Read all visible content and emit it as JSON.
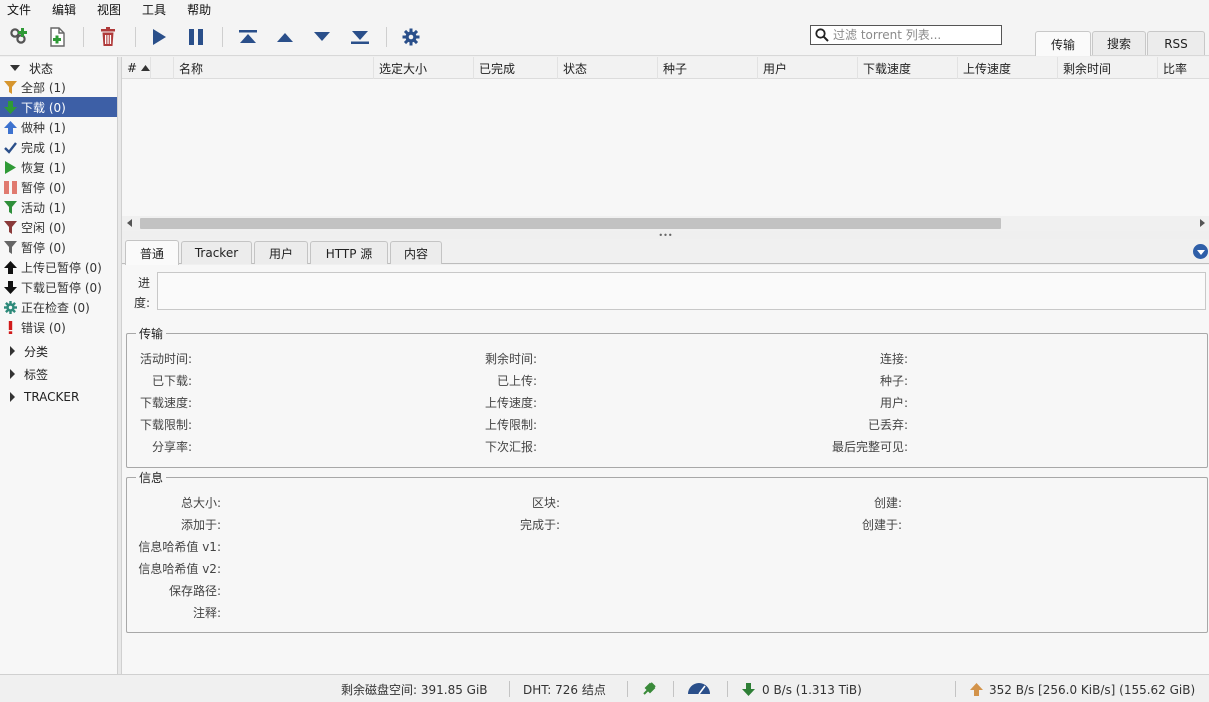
{
  "menubar": [
    "文件",
    "编辑",
    "视图",
    "工具",
    "帮助"
  ],
  "toolbar": {
    "search_placeholder": "过滤 torrent 列表...",
    "tabs": [
      "传输",
      "搜索",
      "RSS"
    ]
  },
  "sidebar": {
    "status_header": "状态",
    "items": [
      {
        "label": "全部 (1)",
        "icon": "funnel-icon"
      },
      {
        "label": "下载 (0)",
        "icon": "download-arrow-icon",
        "selected": true
      },
      {
        "label": "做种 (1)",
        "icon": "upload-arrow-icon"
      },
      {
        "label": "完成 (1)",
        "icon": "checkmark-icon"
      },
      {
        "label": "恢复 (1)",
        "icon": "play-icon"
      },
      {
        "label": "暂停 (0)",
        "icon": "pause-icon"
      },
      {
        "label": "活动 (1)",
        "icon": "funnel-active-icon"
      },
      {
        "label": "空闲 (0)",
        "icon": "funnel-idle-icon"
      },
      {
        "label": "暂停 (0)",
        "icon": "funnel-stalled-icon"
      },
      {
        "label": "上传已暂停 (0)",
        "icon": "upload-stalled-icon"
      },
      {
        "label": "下载已暂停 (0)",
        "icon": "download-stalled-icon"
      },
      {
        "label": "正在检查 (0)",
        "icon": "gear-icon"
      },
      {
        "label": "错误 (0)",
        "icon": "error-icon"
      }
    ],
    "sections": [
      "分类",
      "标签",
      "TRACKER"
    ]
  },
  "list": {
    "columns": [
      "#",
      "名称",
      "选定大小",
      "已完成",
      "状态",
      "种子",
      "用户",
      "下载速度",
      "上传速度",
      "剩余时间",
      "比率"
    ]
  },
  "detail": {
    "tabs": [
      "普通",
      "Tracker",
      "用户",
      "HTTP 源",
      "内容"
    ],
    "progress_label": "进度:",
    "progress_percent": 0,
    "transfer": {
      "legend": "传输",
      "col1": [
        "活动时间:",
        "已下载:",
        "下载速度:",
        "下载限制:",
        "分享率:"
      ],
      "col2": [
        "剩余时间:",
        "已上传:",
        "上传速度:",
        "上传限制:",
        "下次汇报:"
      ],
      "col3": [
        "连接:",
        "种子:",
        "用户:",
        "已丢弃:",
        "最后完整可见:"
      ]
    },
    "info": {
      "legend": "信息",
      "col1": [
        "总大小:",
        "添加于:",
        "信息哈希值 v1:",
        "信息哈希值 v2:",
        "保存路径:",
        "注释:"
      ],
      "col2": [
        "区块:",
        "完成于:"
      ],
      "col3": [
        "创建:",
        "创建于:"
      ]
    }
  },
  "statusbar": {
    "free_space": "剩余磁盘空间: 391.85 GiB",
    "dht": "DHT: 726 结点",
    "download": "0 B/s (1.313 TiB)",
    "upload": "352 B/s [256.0 KiB/s] (155.62 GiB)"
  },
  "colors": {
    "selected": "#3d5fa6",
    "download_green": "#2f9a36",
    "upload_blue": "#3d72cf",
    "upload_orange": "#d3934a"
  }
}
